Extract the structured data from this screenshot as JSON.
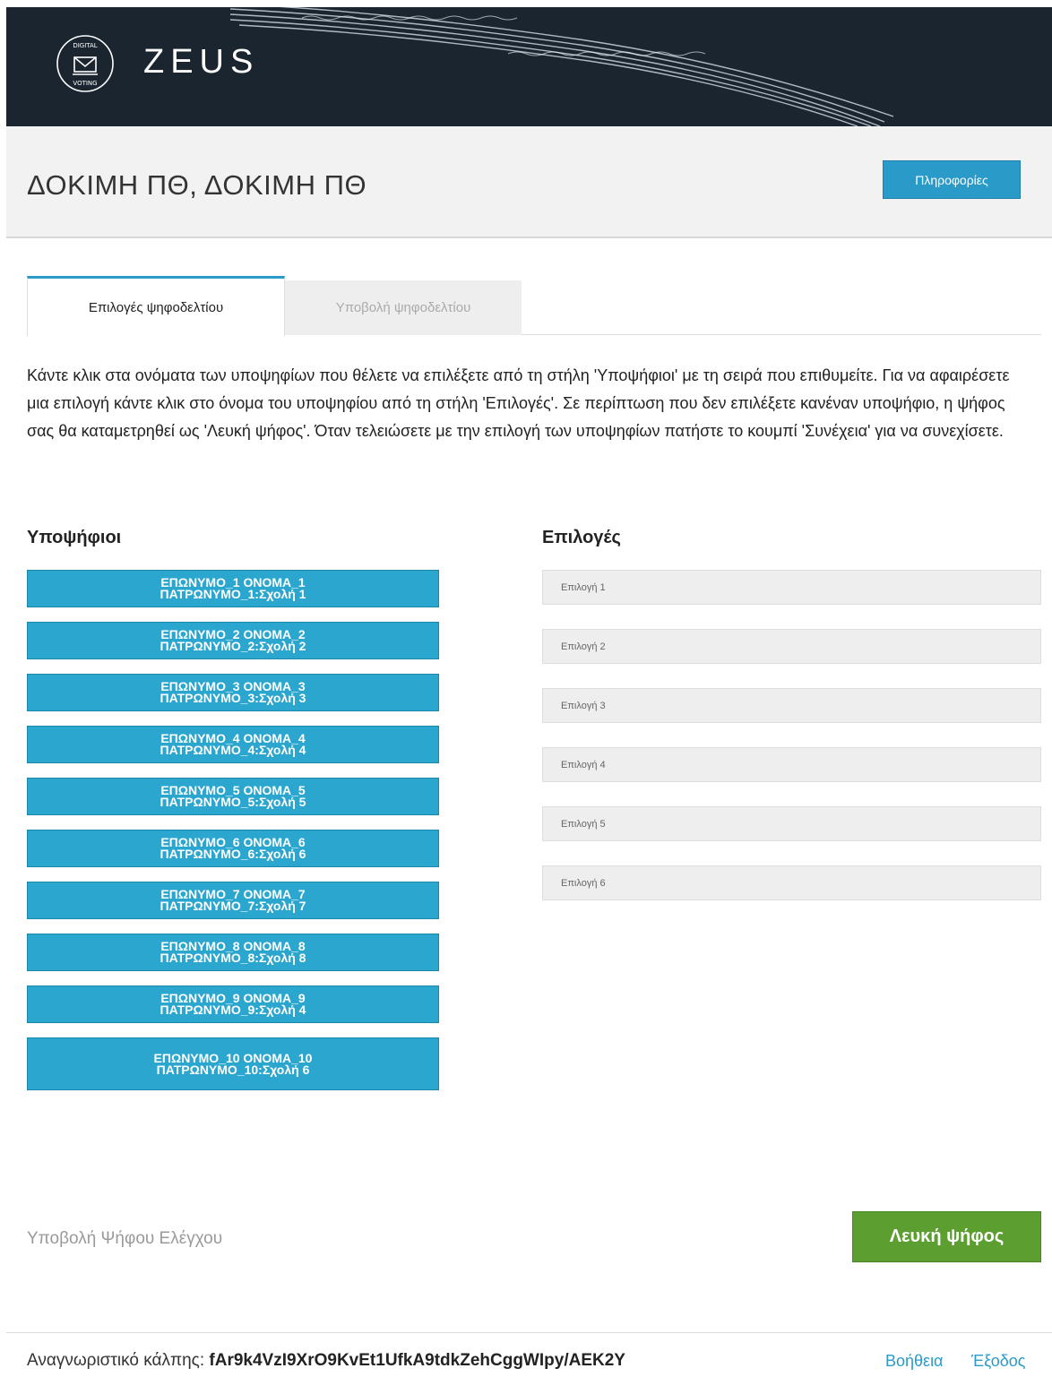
{
  "header": {
    "logo_text": "ZEUS",
    "logo_badge_top": "DIGITAL",
    "logo_badge_bottom": "VOTING"
  },
  "title_bar": {
    "title": "ΔΟΚΙΜΗ ΠΘ, ΔΟΚΙΜΗ ΠΘ",
    "info_button": "Πληροφορίες"
  },
  "tabs": [
    {
      "label": "Επιλογές ψηφοδελτίου",
      "active": true
    },
    {
      "label": "Υποβολή ψηφοδελτίου",
      "active": false
    }
  ],
  "instructions": "Κάντε κλικ στα ονόματα των υποψηφίων που θέλετε να επιλέξετε από τη στήλη 'Υποψήφιοι' με τη σειρά που επιθυμείτε. Για να αφαιρέσετε μια επιλογή κάντε κλικ στο όνομα του υποψηφίου από τη στήλη 'Επιλογές'. Σε περίπτωση που δεν επιλέξετε κανέναν υποψήφιο, η ψήφος σας θα καταμετρηθεί ως 'Λευκή ψήφος'. Όταν τελειώσετε με την επιλογή των υποψηφίων πατήστε το κουμπί 'Συνέχεια' για να συνεχίσετε.",
  "candidates_heading": "Υποψήφιοι",
  "choices_heading": "Επιλογές",
  "candidates": [
    "ΕΠΩΝΥΜΟ_1 ΟΝΟΜΑ_1 ΠΑΤΡΩΝΥΜΟ_1:Σχολή 1",
    "ΕΠΩΝΥΜΟ_2 ΟΝΟΜΑ_2 ΠΑΤΡΩΝΥΜΟ_2:Σχολή 2",
    "ΕΠΩΝΥΜΟ_3 ΟΝΟΜΑ_3 ΠΑΤΡΩΝΥΜΟ_3:Σχολή 3",
    "ΕΠΩΝΥΜΟ_4 ΟΝΟΜΑ_4 ΠΑΤΡΩΝΥΜΟ_4:Σχολή 4",
    "ΕΠΩΝΥΜΟ_5 ΟΝΟΜΑ_5 ΠΑΤΡΩΝΥΜΟ_5:Σχολή 5",
    "ΕΠΩΝΥΜΟ_6 ΟΝΟΜΑ_6 ΠΑΤΡΩΝΥΜΟ_6:Σχολή 6",
    "ΕΠΩΝΥΜΟ_7 ΟΝΟΜΑ_7 ΠΑΤΡΩΝΥΜΟ_7:Σχολή 7",
    "ΕΠΩΝΥΜΟ_8 ΟΝΟΜΑ_8 ΠΑΤΡΩΝΥΜΟ_8:Σχολή 8",
    "ΕΠΩΝΥΜΟ_9 ΟΝΟΜΑ_9 ΠΑΤΡΩΝΥΜΟ_9:Σχολή 4",
    "ΕΠΩΝΥΜΟ_10 ΟΝΟΜΑ_10 ΠΑΤΡΩΝΥΜΟ_10:Σχολή 6"
  ],
  "choices": [
    "Επιλογή 1",
    "Επιλογή 2",
    "Επιλογή 3",
    "Επιλογή 4",
    "Επιλογή 5",
    "Επιλογή 6"
  ],
  "test_vote_link": "Υποβολή Ψήφου Ελέγχου",
  "blank_vote_button": "Λευκή ψήφος",
  "footer": {
    "voter_id_label": "Αναγνωριστικό κάλπης:",
    "voter_id_value": "fAr9k4VzI9XrO9KvEt1UfkA9tdkZehCggWIpy/AEK2Y",
    "help_link": "Βοήθεια",
    "logout_link": "Έξοδος"
  },
  "colors": {
    "header_bg": "#1a2530",
    "accent_blue": "#2aa6cf",
    "green_button": "#5c9e2f"
  }
}
